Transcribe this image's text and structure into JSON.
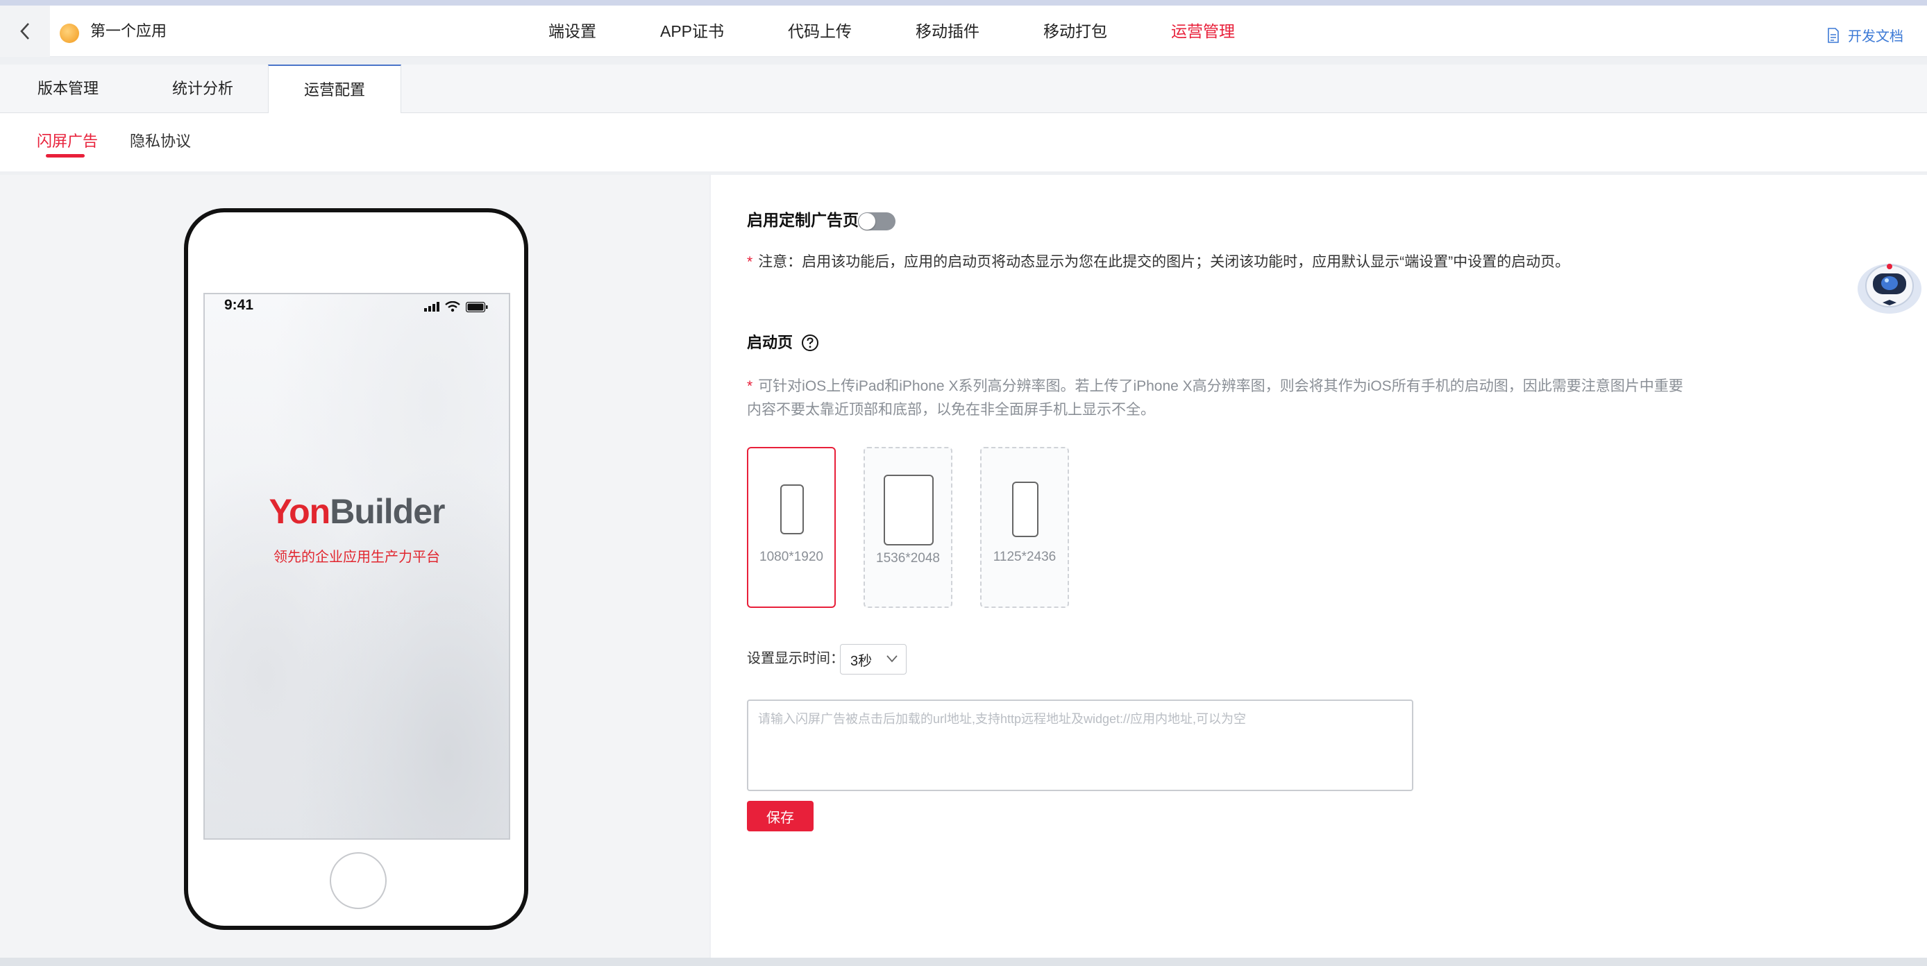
{
  "header": {
    "app_name": "第一个应用",
    "nav": [
      {
        "label": "端设置",
        "active": false
      },
      {
        "label": "APP证书",
        "active": false
      },
      {
        "label": "代码上传",
        "active": false
      },
      {
        "label": "移动插件",
        "active": false
      },
      {
        "label": "移动打包",
        "active": false
      },
      {
        "label": "运营管理",
        "active": true
      }
    ],
    "doc_link": "开发文档"
  },
  "subtabs": [
    {
      "label": "版本管理",
      "active": false
    },
    {
      "label": "统计分析",
      "active": false
    },
    {
      "label": "运营配置",
      "active": true
    }
  ],
  "thirdtabs": [
    {
      "label": "闪屏广告",
      "active": true
    },
    {
      "label": "隐私协议",
      "active": false
    }
  ],
  "preview": {
    "status_time": "9:41",
    "brand_part1": "Yon",
    "brand_part2": "Builder",
    "brand_slogan": "领先的企业应用生产力平台"
  },
  "settings": {
    "toggle_label": "启用定制广告页",
    "toggle_on": false,
    "note1_star": "*",
    "note1": "注意：启用该功能后，应用的启动页将动态显示为您在此提交的图片；关闭该功能时，应用默认显示“端设置”中设置的启动页。",
    "section_title": "启动页",
    "note2_star": "*",
    "note2": "可针对iOS上传iPad和iPhone X系列高分辨率图。若上传了iPhone X高分辨率图，则会将其作为iOS所有手机的启动图，因此需要注意图片中重要内容不要太靠近顶部和底部，以免在非全面屏手机上显示不全。",
    "sizes": [
      {
        "label": "1080*1920",
        "selected": true
      },
      {
        "label": "1536*2048",
        "selected": false
      },
      {
        "label": "1125*2436",
        "selected": false
      }
    ],
    "time_label": "设置显示时间：",
    "time_value": "3秒",
    "url_placeholder": "请输入闪屏广告被点击后加载的url地址,支持http远程地址及widget://应用内地址,可以为空",
    "url_value": "",
    "save_label": "保存"
  },
  "colors": {
    "accent": "#e8203a",
    "link": "#3d7ad6",
    "tab_indicator": "#4a75c9"
  }
}
